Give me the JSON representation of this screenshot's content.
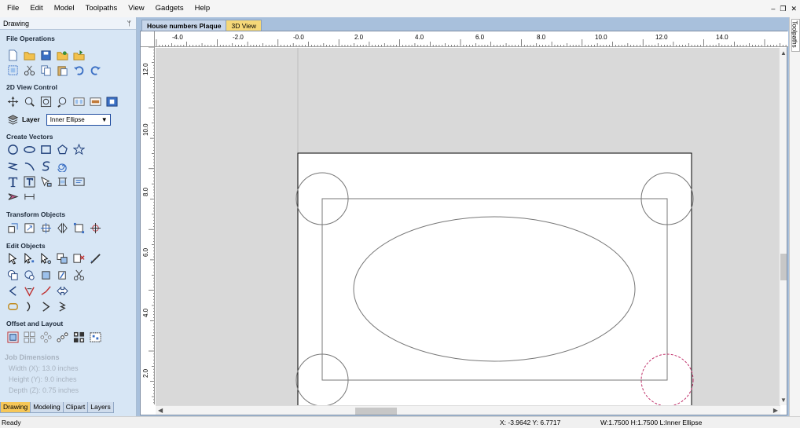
{
  "menubar": {
    "items": [
      "File",
      "Edit",
      "Model",
      "Toolpaths",
      "View",
      "Gadgets",
      "Help"
    ],
    "window_controls": {
      "minimize": "–",
      "restore": "❐",
      "close": "✕"
    }
  },
  "left_panel": {
    "header_title": "Drawing",
    "pin_glyph": "ᛘ",
    "sections": {
      "file_ops": "File Operations",
      "view_ctrl": "2D View Control",
      "create_vec": "Create Vectors",
      "transform": "Transform Objects",
      "edit_obj": "Edit Objects",
      "offset": "Offset and Layout"
    },
    "layer": {
      "label": "Layer",
      "selected": "Inner Ellipse",
      "arrow": "▼"
    },
    "job_dimensions": {
      "title": "Job Dimensions",
      "width": "Width  (X): 13.0 inches",
      "height": "Height (Y): 9.0 inches",
      "depth": "Depth  (Z): 0.75 inches"
    },
    "bottom_tabs": [
      "Drawing",
      "Modeling",
      "Clipart",
      "Layers"
    ]
  },
  "right_panel": {
    "tab_label": "Toolpaths"
  },
  "document": {
    "tabs": [
      "House numbers Plaque",
      "3D View"
    ],
    "ruler_h_labels": [
      "-4.0",
      "-2.0",
      "-0.0",
      "2.0",
      "4.0",
      "6.0",
      "8.0",
      "10.0",
      "12.0",
      "14.0"
    ],
    "ruler_v_labels": [
      "12.0",
      "10.0",
      "8.0",
      "6.0",
      "4.0",
      "2.0"
    ]
  },
  "scroll_arrows": {
    "up": "▲",
    "down": "▼",
    "left": "◀",
    "right": "▶"
  },
  "status": {
    "ready": "Ready",
    "xy": "X: -3.9642 Y:  6.7717",
    "wh": "W:1.7500   H:1.7500  L:Inner Ellipse"
  },
  "colors": {
    "panel_bg": "#d7e6f5",
    "doc_frame": "#a8c0dc",
    "active_tab": "#f6c758",
    "selection_dash": "#c0306a"
  }
}
